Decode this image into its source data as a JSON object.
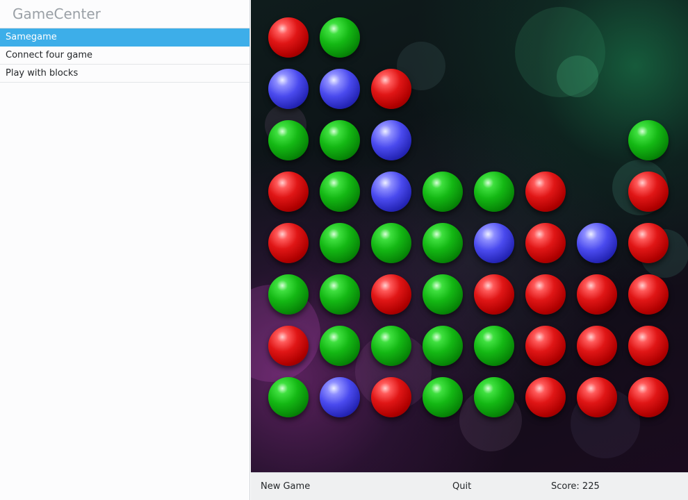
{
  "app": {
    "title": "GameCenter"
  },
  "sidebar": {
    "items": [
      {
        "label": "Samegame",
        "active": true
      },
      {
        "label": "Connect four game",
        "active": false
      },
      {
        "label": "Play with blocks",
        "active": false
      }
    ]
  },
  "game": {
    "board": {
      "columns": 8,
      "rows": 8,
      "cells": [
        [
          "red",
          "green",
          null,
          null,
          null,
          null,
          null,
          null
        ],
        [
          "blue",
          "blue",
          "red",
          null,
          null,
          null,
          null,
          null
        ],
        [
          "green",
          "green",
          "blue",
          null,
          null,
          null,
          null,
          "green"
        ],
        [
          "red",
          "green",
          "blue",
          "green",
          "green",
          "red",
          null,
          "red"
        ],
        [
          "red",
          "green",
          "green",
          "green",
          "blue",
          "red",
          "blue",
          "red"
        ],
        [
          "green",
          "green",
          "red",
          "green",
          "red",
          "red",
          "red",
          "red"
        ],
        [
          "red",
          "green",
          "green",
          "green",
          "green",
          "red",
          "red",
          "red"
        ],
        [
          "green",
          "blue",
          "red",
          "green",
          "green",
          "red",
          "red",
          "red"
        ]
      ]
    },
    "controls": {
      "new_game_label": "New Game",
      "quit_label": "Quit",
      "score_label": "Score: 225"
    }
  },
  "colors": {
    "accent": "#3daee9",
    "red": "#e01616",
    "green": "#14b814",
    "blue": "#4a4aee"
  }
}
